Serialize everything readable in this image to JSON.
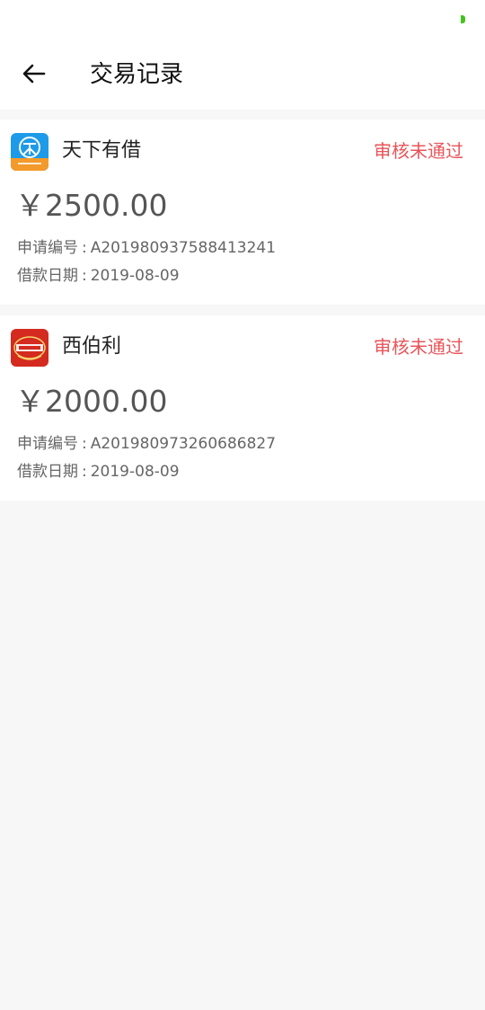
{
  "header": {
    "title": "交易记录",
    "back_icon": "arrow-left-icon"
  },
  "colors": {
    "status_red": "#e8555a",
    "battery_green": "#46c21f"
  },
  "labels": {
    "application_no": "申请编号",
    "loan_date": "借款日期"
  },
  "records": [
    {
      "app_name": "天下有借",
      "logo_icon": "tianxia-youjie-logo",
      "status": "审核未通过",
      "amount": "￥2500.00",
      "application_no": "A201980937588413241",
      "loan_date": "2019-08-09"
    },
    {
      "app_name": "西伯利",
      "logo_icon": "xiboli-logo",
      "status": "审核未通过",
      "amount": "￥2000.00",
      "application_no": "A201980973260686827",
      "loan_date": "2019-08-09"
    }
  ]
}
